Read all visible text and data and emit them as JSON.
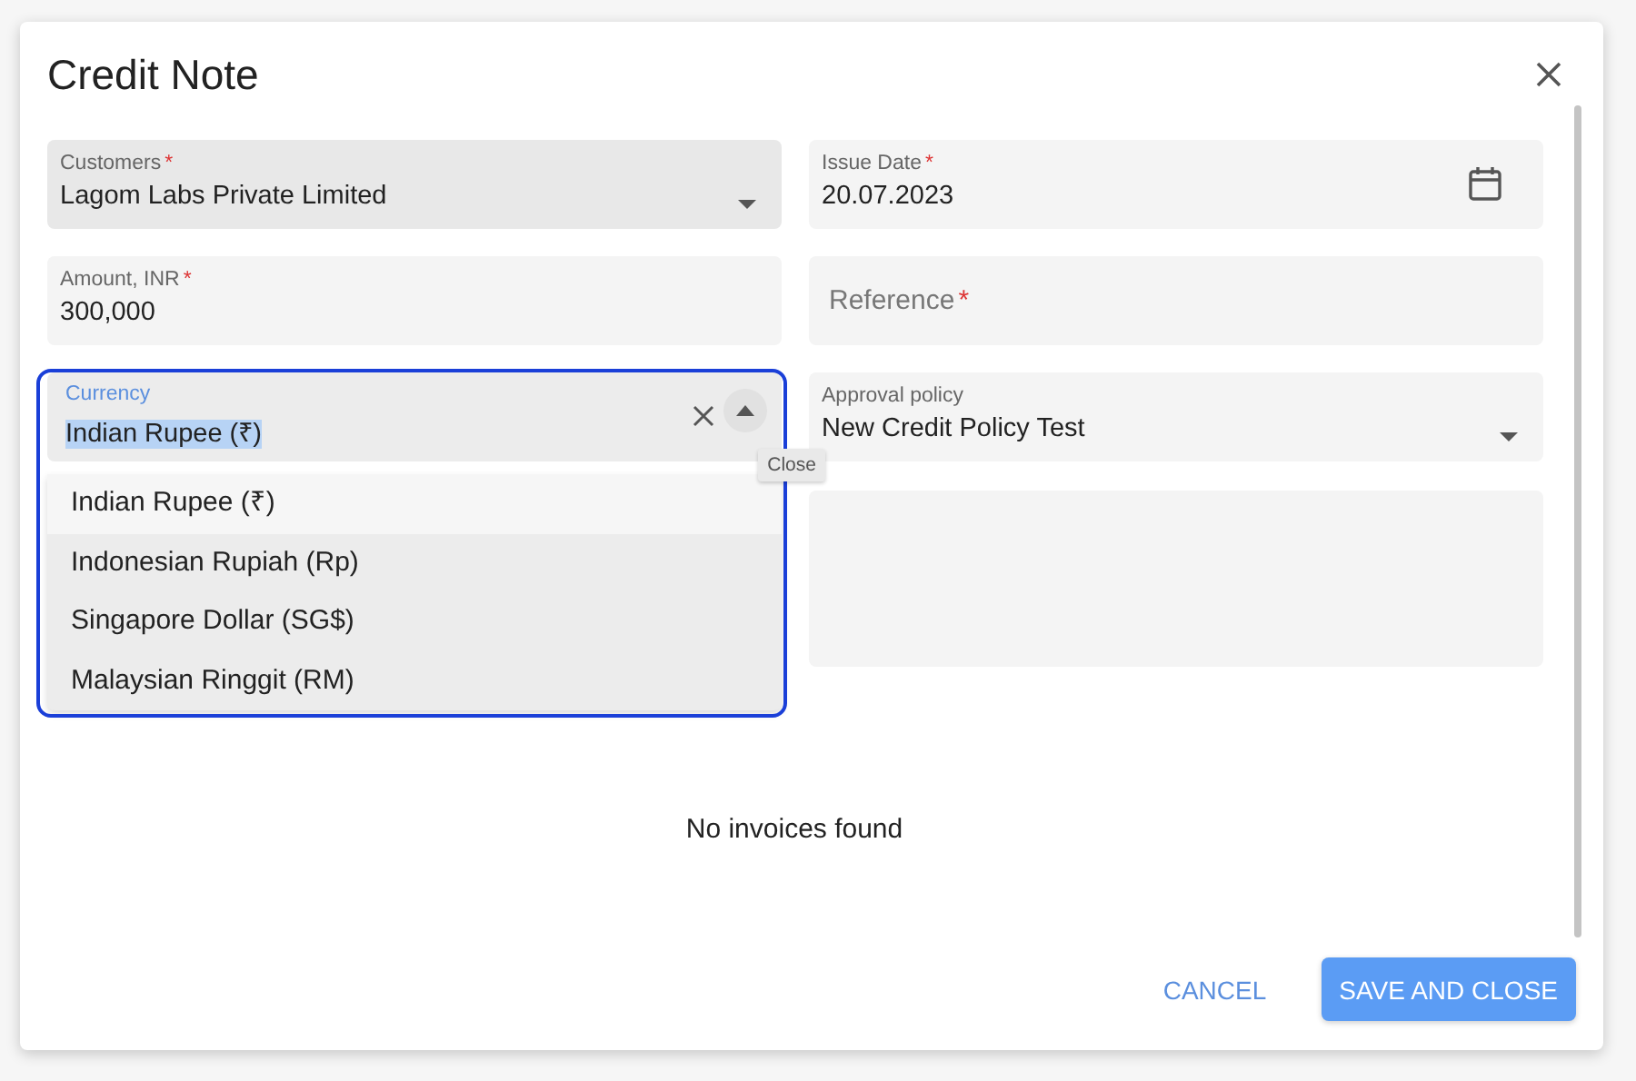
{
  "dialog": {
    "title": "Credit Note"
  },
  "fields": [
    {
      "kind": "select",
      "label": "Customers",
      "mark": "*",
      "value": "Lagom Labs Private Limited"
    },
    {
      "kind": "date",
      "label": "Issue Date",
      "mark": "*",
      "value": "20.07.2023"
    },
    {
      "kind": "text",
      "label": "Amount, INR",
      "mark": "*",
      "value": "300,000"
    },
    {
      "kind": "empty",
      "label": "Reference",
      "mark": "*"
    },
    {
      "kind": "combo",
      "label": "Currency",
      "value": "Indian Rupee (₹)",
      "expanded": true
    },
    {
      "kind": "select",
      "label": "Approval policy",
      "value": "New Credit Policy Test"
    },
    {
      "kind": "area"
    }
  ],
  "currency_options": [
    {
      "label": "Indian Rupee (₹)",
      "selected": true
    },
    {
      "label": "Indonesian Rupiah (Rp)",
      "selected": false
    },
    {
      "label": "Singapore Dollar (SG$)",
      "selected": false
    },
    {
      "label": "Malaysian Ringgit (RM)",
      "selected": false
    }
  ],
  "tooltip": "Close",
  "empty_message": "No invoices found",
  "buttons": [
    {
      "kind": "text",
      "label": "CANCEL"
    },
    {
      "kind": "primary",
      "label": "SAVE AND CLOSE"
    }
  ]
}
